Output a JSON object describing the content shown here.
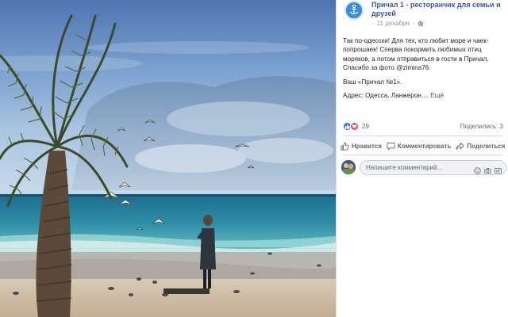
{
  "post": {
    "page_name": "Причал 1 - ресторанчик для семьи и друзей",
    "date": "11 декабря",
    "dot": "·",
    "text_p1": "Так по-одесски! Для тех, кто любит море и чаек-попрошаек! Сперва покормить любимых птиц моряков, а потом отправиться в гости в Причал. Спасибо за фото @zimina76.",
    "text_p2": "Ваш «Причал №1».",
    "text_p3": "Адрес: Одесса, Ланжерон....",
    "more_link": "Ещё",
    "avatar_icon": "anchor-icon",
    "privacy_icon": "globe-icon"
  },
  "reactions": {
    "count": "29",
    "shares": "Поделились: 3",
    "like_icon": "thumbs-up-icon",
    "love_icon": "heart-icon",
    "like_color": "#1877f2",
    "love_color": "#f33e58"
  },
  "actions": {
    "like": "Нравится",
    "comment": "Комментировать",
    "share": "Поделиться"
  },
  "comment": {
    "placeholder": "Напишите комментарий...",
    "icons": [
      "emoji-icon",
      "camera-icon",
      "gif-icon"
    ]
  },
  "colors": {
    "link": "#385898",
    "text": "#1d2129",
    "muted": "#606770"
  }
}
